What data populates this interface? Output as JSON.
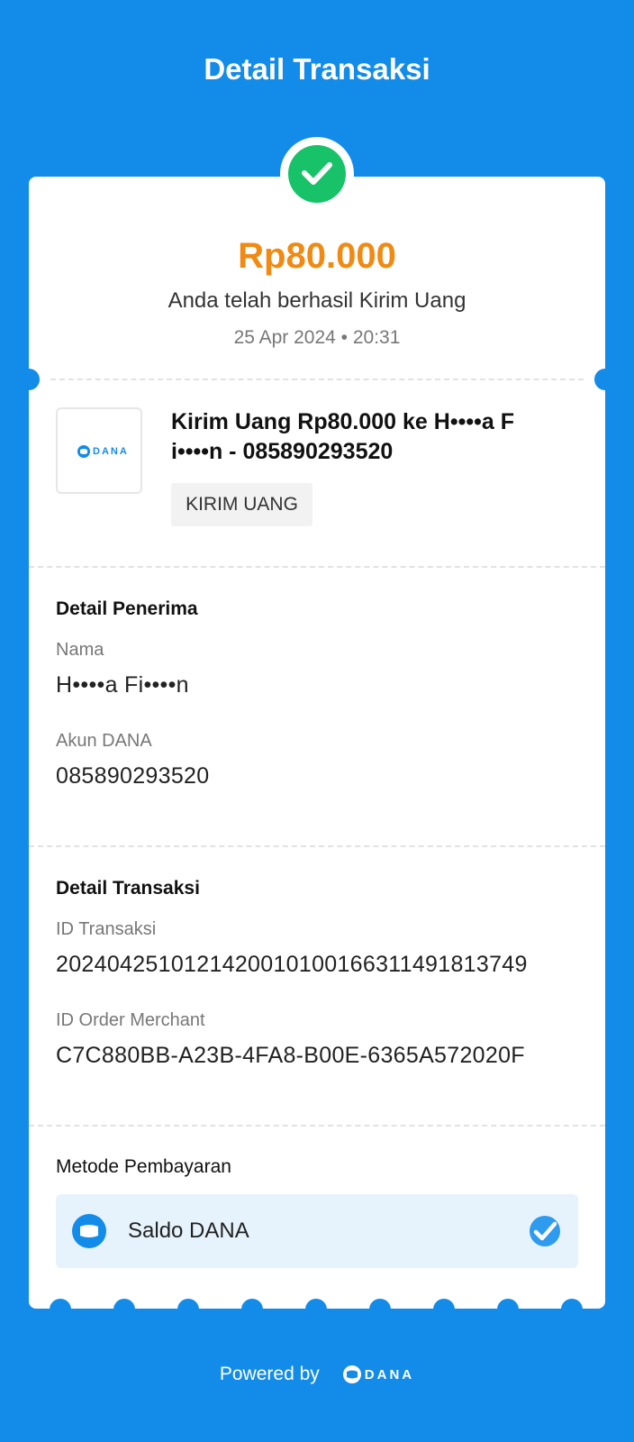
{
  "header": {
    "title": "Detail Transaksi"
  },
  "summary": {
    "amount": "Rp80.000",
    "status": "Anda telah berhasil Kirim Uang",
    "datetime": "25 Apr 2024 • 20:31"
  },
  "transaction": {
    "logo_text": "DANA",
    "title": "Kirim Uang Rp80.000 ke H••••a F i••••n - 085890293520",
    "tag": "KIRIM UANG"
  },
  "recipient": {
    "section_title": "Detail Penerima",
    "name_label": "Nama",
    "name_value": "H••••a Fi••••n",
    "account_label": "Akun DANA",
    "account_value": "085890293520"
  },
  "details": {
    "section_title": "Detail Transaksi",
    "tx_id_label": "ID Transaksi",
    "tx_id_value": "2024042510121420010100166311491813749",
    "order_id_label": "ID Order Merchant",
    "order_id_value": "C7C880BB-A23B-4FA8-B00E-6365A572020F"
  },
  "payment": {
    "label": "Metode Pembayaran",
    "method": "Saldo DANA"
  },
  "footer": {
    "powered_by": "Powered by",
    "brand": "DANA"
  },
  "colors": {
    "background": "#128CE8",
    "amount": "#F08A12",
    "success": "#18C268",
    "payment_box": "#E6F3FD"
  }
}
